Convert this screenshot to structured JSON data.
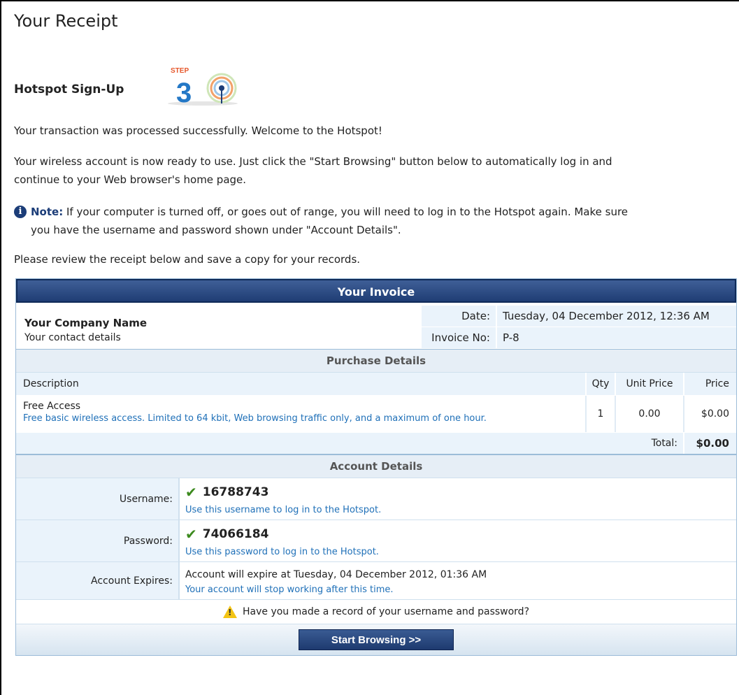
{
  "page": {
    "title": "Your Receipt",
    "step_title": "Hotspot Sign-Up",
    "step_label": "STEP",
    "step_number": "3"
  },
  "messages": {
    "success": "Your transaction was processed successfully. Welcome to the Hotspot!",
    "ready_line1": "Your wireless account is now ready to use. Just click the \"Start Browsing\" button below to automatically log in and",
    "ready_line2": "continue to your Web browser's home page.",
    "note_label": "Note:",
    "note_line1": " If your computer is turned off, or goes out of range, you will need to log in to the Hotspot again. Make sure",
    "note_line2": "you have the username and password shown under \"Account Details\".",
    "review": "Please review the receipt below and save a copy for your records."
  },
  "invoice": {
    "header": "Your Invoice",
    "company_name": "Your Company Name",
    "company_contact": "Your contact details",
    "date_label": "Date:",
    "date_value": "Tuesday, 04 December 2012, 12:36 AM",
    "invoice_no_label": "Invoice No:",
    "invoice_no_value": "P-8"
  },
  "purchase": {
    "section_title": "Purchase Details",
    "columns": {
      "description": "Description",
      "qty": "Qty",
      "unit_price": "Unit Price",
      "price": "Price"
    },
    "items": [
      {
        "name": "Free Access",
        "detail": "Free basic wireless access. Limited to 64 kbit, Web browsing traffic only, and a maximum of one hour.",
        "qty": "1",
        "unit_price": "0.00",
        "price": "$0.00"
      }
    ],
    "total_label": "Total:",
    "total_value": "$0.00"
  },
  "account": {
    "section_title": "Account Details",
    "username_label": "Username:",
    "username_value": "16788743",
    "username_hint": "Use this username to log in to the Hotspot.",
    "password_label": "Password:",
    "password_value": "74066184",
    "password_hint": "Use this password to log in to the Hotspot.",
    "expires_label": "Account Expires:",
    "expires_value": "Account will expire at Tuesday, 04 December 2012, 01:36 AM",
    "expires_hint": "Your account will stop working after this time.",
    "warning": "Have you made a record of your username and password?"
  },
  "actions": {
    "start_browsing": "Start Browsing >>"
  },
  "colors": {
    "header_blue": "#1f3d74",
    "link_blue": "#1f70b8",
    "check_green": "#3c8a1e",
    "warning_yellow": "#f3c414"
  }
}
